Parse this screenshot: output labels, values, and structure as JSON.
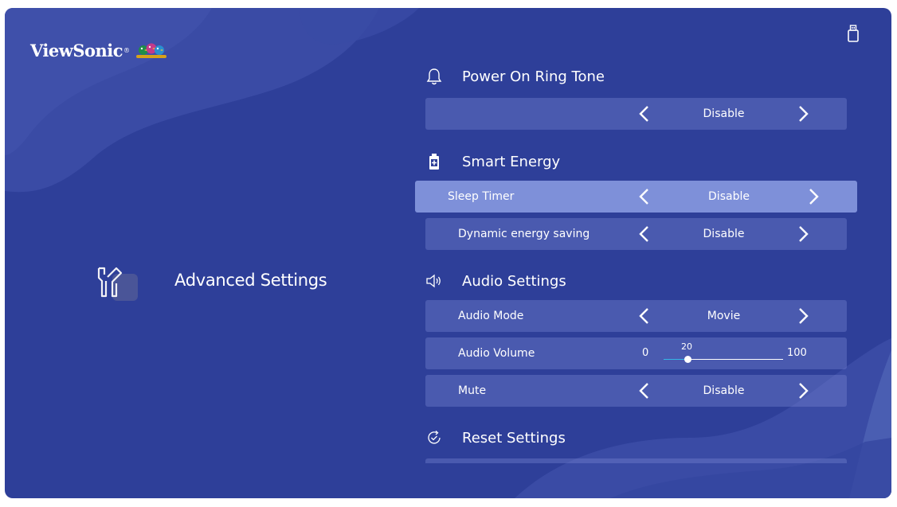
{
  "brand": {
    "name": "ViewSonic",
    "mark": "®"
  },
  "left_panel": {
    "title": "Advanced Settings",
    "icon": "tools-icon"
  },
  "status": {
    "usb_icon": "usb-icon"
  },
  "sections": {
    "power_on_ring_tone": {
      "title": "Power On Ring Tone",
      "icon": "bell-icon",
      "value": "Disable"
    },
    "smart_energy": {
      "title": "Smart Energy",
      "icon": "battery-icon",
      "sleep_timer": {
        "label": "Sleep Timer",
        "value": "Disable"
      },
      "dynamic_energy_saving": {
        "label": "Dynamic energy saving",
        "value": "Disable"
      }
    },
    "audio_settings": {
      "title": "Audio Settings",
      "icon": "speaker-icon",
      "audio_mode": {
        "label": "Audio Mode",
        "value": "Movie"
      },
      "audio_volume": {
        "label": "Audio Volume",
        "min": "0",
        "max": "100",
        "value": "20",
        "level": 0.2
      },
      "mute": {
        "label": "Mute",
        "value": "Disable"
      }
    },
    "reset_settings": {
      "title": "Reset Settings",
      "icon": "reset-check-icon"
    }
  },
  "colors": {
    "background": "#2e3f99",
    "selected_row": "#7e90d9",
    "slider_fill": "#35b6e6"
  }
}
